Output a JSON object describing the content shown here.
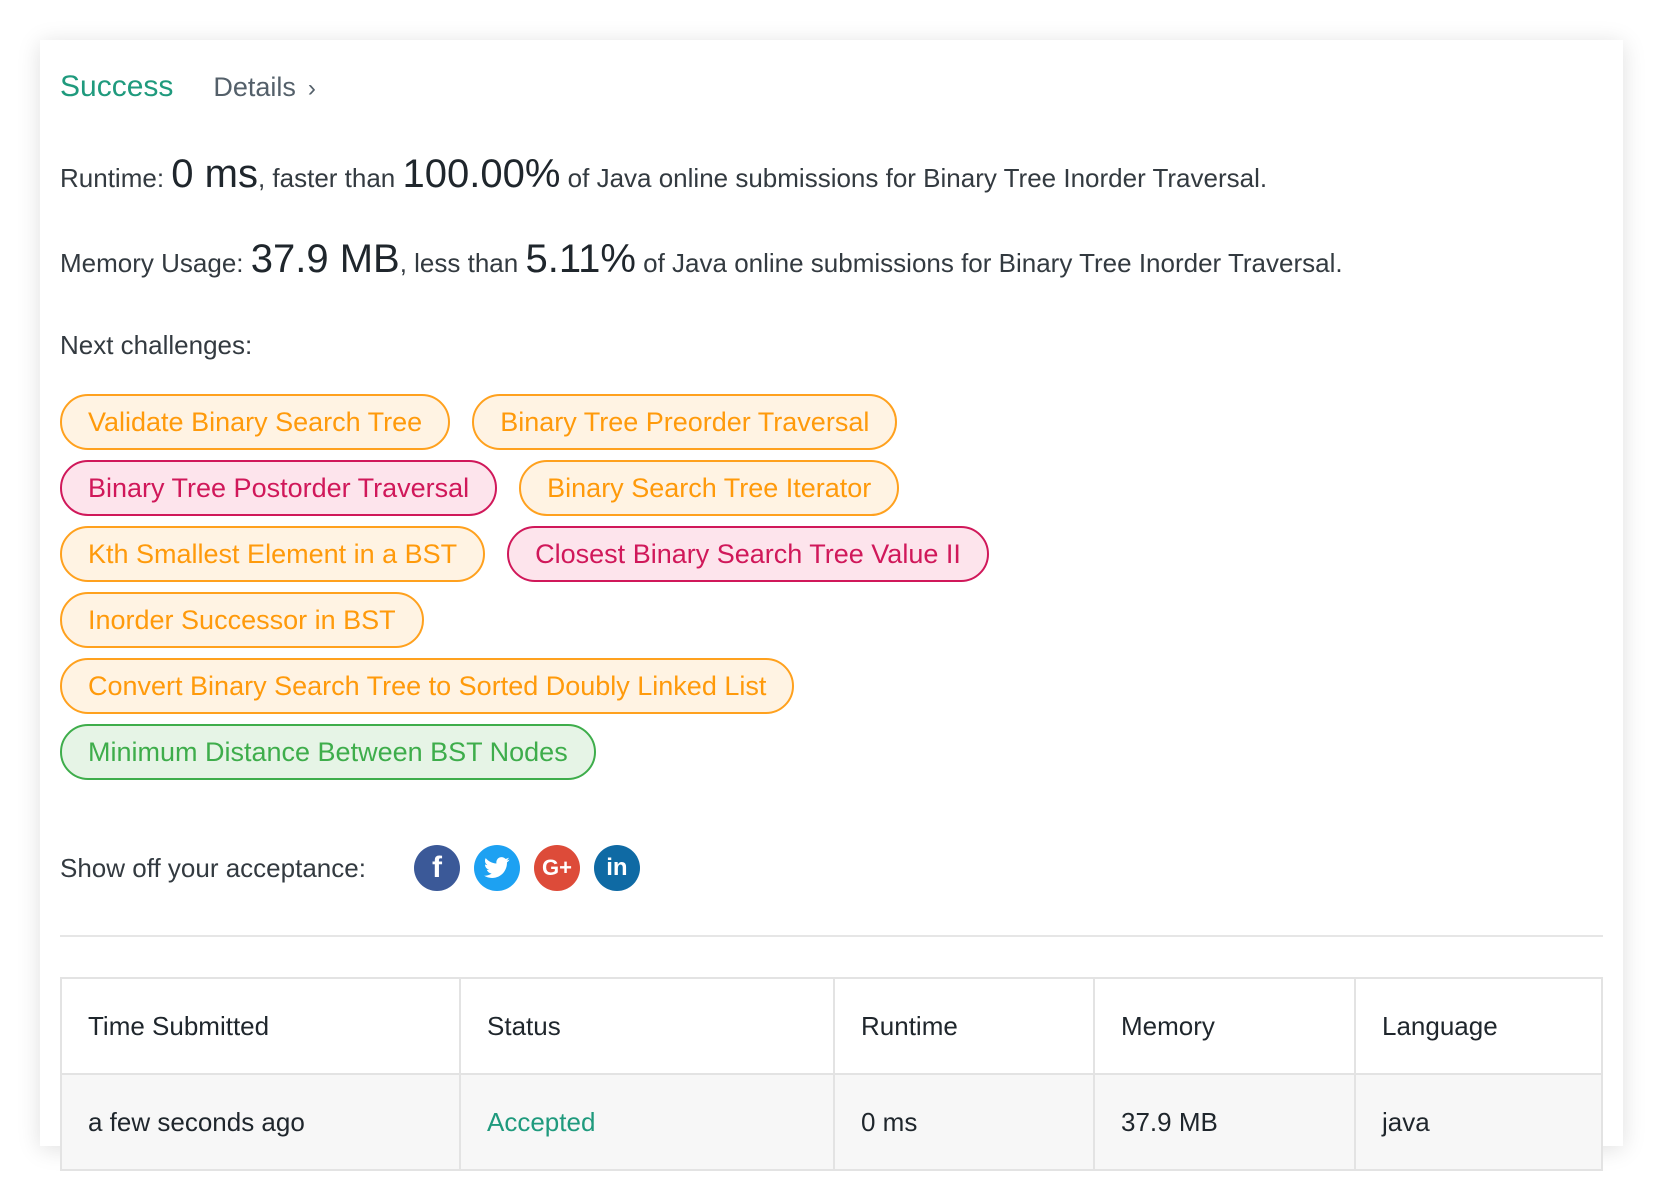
{
  "header": {
    "status": "Success",
    "details_label": "Details",
    "chevron_glyph": "›"
  },
  "runtime": {
    "label": "Runtime:",
    "value": "0 ms",
    "comparison": ", faster than",
    "percent": "100.00%",
    "suffix": "of Java online submissions for Binary Tree Inorder Traversal."
  },
  "memory": {
    "label": "Memory Usage:",
    "value": "37.9 MB",
    "comparison": ", less than",
    "percent": "5.11%",
    "suffix": "of Java online submissions for Binary Tree Inorder Traversal."
  },
  "next_challenges": {
    "label": "Next challenges:",
    "items": [
      {
        "title": "Validate Binary Search Tree",
        "difficulty": "medium"
      },
      {
        "title": "Binary Tree Preorder Traversal",
        "difficulty": "medium"
      },
      {
        "title": "Binary Tree Postorder Traversal",
        "difficulty": "hard"
      },
      {
        "title": "Binary Search Tree Iterator",
        "difficulty": "medium"
      },
      {
        "title": "Kth Smallest Element in a BST",
        "difficulty": "medium"
      },
      {
        "title": "Closest Binary Search Tree Value II",
        "difficulty": "hard"
      },
      {
        "title": "Inorder Successor in BST",
        "difficulty": "medium"
      },
      {
        "title": "Convert Binary Search Tree to Sorted Doubly Linked List",
        "difficulty": "medium"
      },
      {
        "title": "Minimum Distance Between BST Nodes",
        "difficulty": "easy"
      }
    ]
  },
  "share": {
    "label": "Show off your acceptance:",
    "icons": [
      {
        "name": "facebook-icon",
        "glyph": "f",
        "color": "#3b5998"
      },
      {
        "name": "twitter-icon",
        "glyph": "",
        "color": "#1da1f2"
      },
      {
        "name": "google-plus-icon",
        "glyph": "G+",
        "color": "#dd4b39"
      },
      {
        "name": "linkedin-icon",
        "glyph": "in",
        "color": "#0f6aa4"
      }
    ]
  },
  "table": {
    "headers": [
      "Time Submitted",
      "Status",
      "Runtime",
      "Memory",
      "Language"
    ],
    "rows": [
      [
        "a few seconds ago",
        "Accepted",
        "0 ms",
        "37.9 MB",
        "java"
      ]
    ]
  },
  "colors": {
    "success": "#1f9a7d",
    "medium": "#ff9a0b",
    "hard": "#d0185a",
    "easy": "#3ead4b"
  }
}
